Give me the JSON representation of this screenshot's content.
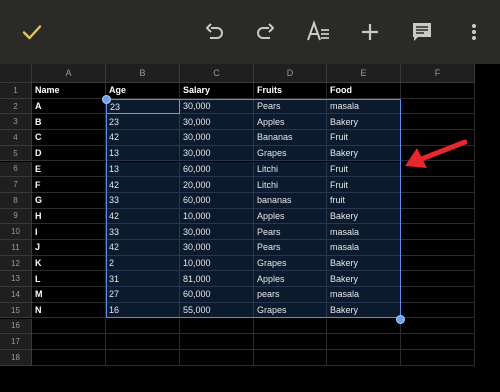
{
  "toolbar": {
    "icons": [
      "check-icon",
      "undo-icon",
      "redo-icon",
      "text-format-icon",
      "add-icon",
      "comment-icon",
      "more-vert-icon"
    ],
    "check_color": "#e8c255",
    "icon_color": "#c9c9c6"
  },
  "sheet": {
    "columns": [
      "A",
      "B",
      "C",
      "D",
      "E",
      "F"
    ],
    "rows": [
      "1",
      "2",
      "3",
      "4",
      "5",
      "6",
      "7",
      "8",
      "9",
      "10",
      "11",
      "12",
      "13",
      "14",
      "15",
      "16",
      "17",
      "18"
    ],
    "header": [
      "Name",
      "Age",
      "Salary",
      "Fruits",
      "Food"
    ],
    "data": [
      [
        "A",
        "23",
        "30,000",
        "Pears",
        "masala"
      ],
      [
        "B",
        "23",
        "30,000",
        "Apples",
        "Bakery"
      ],
      [
        "C",
        "42",
        "30,000",
        "Bananas",
        "Fruit"
      ],
      [
        "D",
        "13",
        "30,000",
        "Grapes",
        "Bakery"
      ],
      [
        "E",
        "13",
        "60,000",
        "Litchi",
        "Fruit"
      ],
      [
        "F",
        "42",
        "20,000",
        "Litchi",
        "Fruit"
      ],
      [
        "G",
        "33",
        "60,000",
        "bananas",
        "fruit"
      ],
      [
        "H",
        "42",
        "10,000",
        "Apples",
        "Bakery"
      ],
      [
        "I",
        "33",
        "30,000",
        "Pears",
        "masala"
      ],
      [
        "J",
        "42",
        "30,000",
        "Pears",
        "masala"
      ],
      [
        "K",
        "2",
        "10,000",
        "Grapes",
        "Bakery"
      ],
      [
        "L",
        "31",
        "81,000",
        "Apples",
        "Bakery"
      ],
      [
        "M",
        "27",
        "60,000",
        "pears",
        "masala"
      ],
      [
        "N",
        "16",
        "55,000",
        "Grapes",
        "Bakery"
      ]
    ],
    "selection_color": "#5b8ee6",
    "arrow_color": "#e8262e"
  }
}
